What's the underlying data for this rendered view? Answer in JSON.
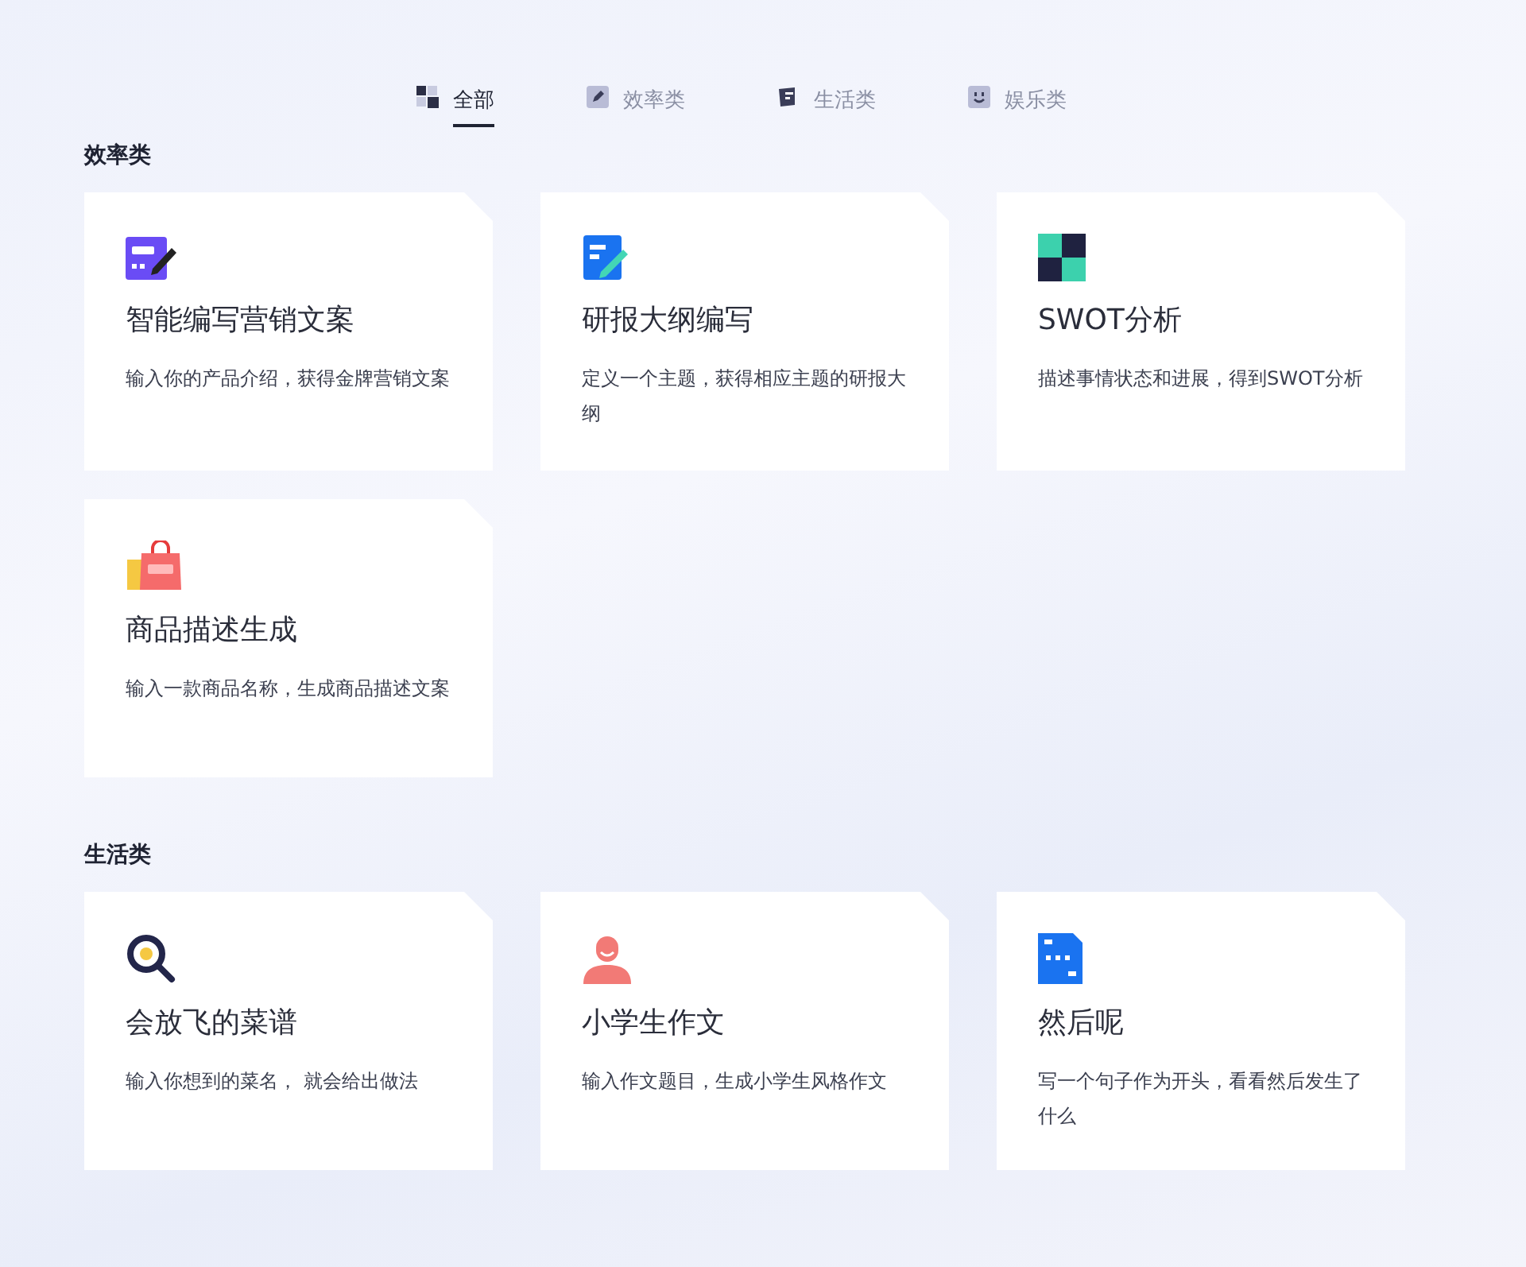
{
  "tabs": [
    {
      "label": "全部",
      "selected": true
    },
    {
      "label": "效率类",
      "selected": false
    },
    {
      "label": "生活类",
      "selected": false
    },
    {
      "label": "娱乐类",
      "selected": false
    }
  ],
  "sections": [
    {
      "title": "效率类",
      "cards": [
        {
          "title": "智能编写营销文案",
          "description": "输入你的产品介绍，获得金牌营销文案"
        },
        {
          "title": "研报大纲编写",
          "description": "定义一个主题，获得相应主题的研报大纲"
        },
        {
          "title": "SWOT分析",
          "description": "描述事情状态和进展，得到SWOT分析"
        },
        {
          "title": "商品描述生成",
          "description": "输入一款商品名称，生成商品描述文案"
        }
      ]
    },
    {
      "title": "生活类",
      "cards": [
        {
          "title": "会放飞的菜谱",
          "description": "输入你想到的菜名， 就会给出做法"
        },
        {
          "title": "小学生作文",
          "description": "输入作文题目，生成小学生风格作文"
        },
        {
          "title": "然后呢",
          "description": "写一个句子作为开头，看看然后发生了什么"
        }
      ]
    }
  ]
}
